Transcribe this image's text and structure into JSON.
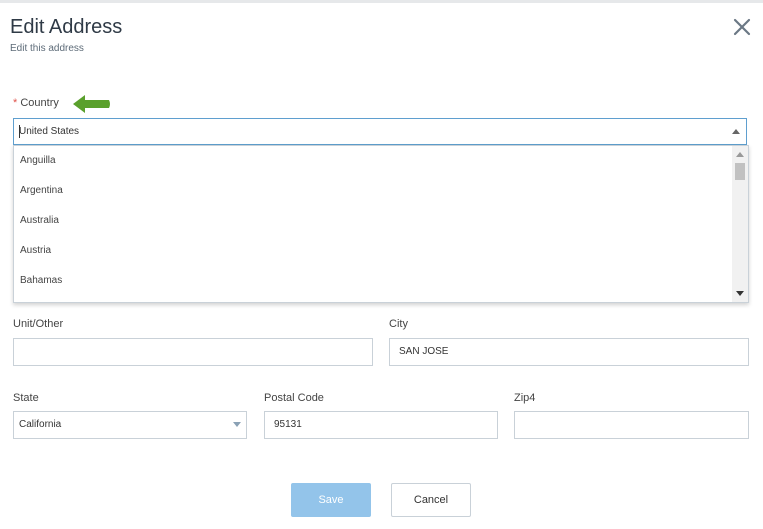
{
  "dialog": {
    "title": "Edit Address",
    "subtitle": "Edit this address",
    "close_icon": "close-x-icon"
  },
  "country": {
    "required_marker": "*",
    "label": "Country",
    "value": "United States",
    "options": [
      "Anguilla",
      "Argentina",
      "Australia",
      "Austria",
      "Bahamas"
    ]
  },
  "annotation": {
    "arrow_color": "#5aa02c"
  },
  "unit_other": {
    "label": "Unit/Other",
    "value": ""
  },
  "city": {
    "label": "City",
    "value": "SAN JOSE"
  },
  "state": {
    "label": "State",
    "value": "California"
  },
  "postal_code": {
    "label": "Postal Code",
    "value": "95131"
  },
  "zip4": {
    "label": "Zip4",
    "value": ""
  },
  "buttons": {
    "save": "Save",
    "cancel": "Cancel"
  },
  "colors": {
    "accent": "#5f9fcf",
    "save_disabled": "#93c4ea"
  }
}
